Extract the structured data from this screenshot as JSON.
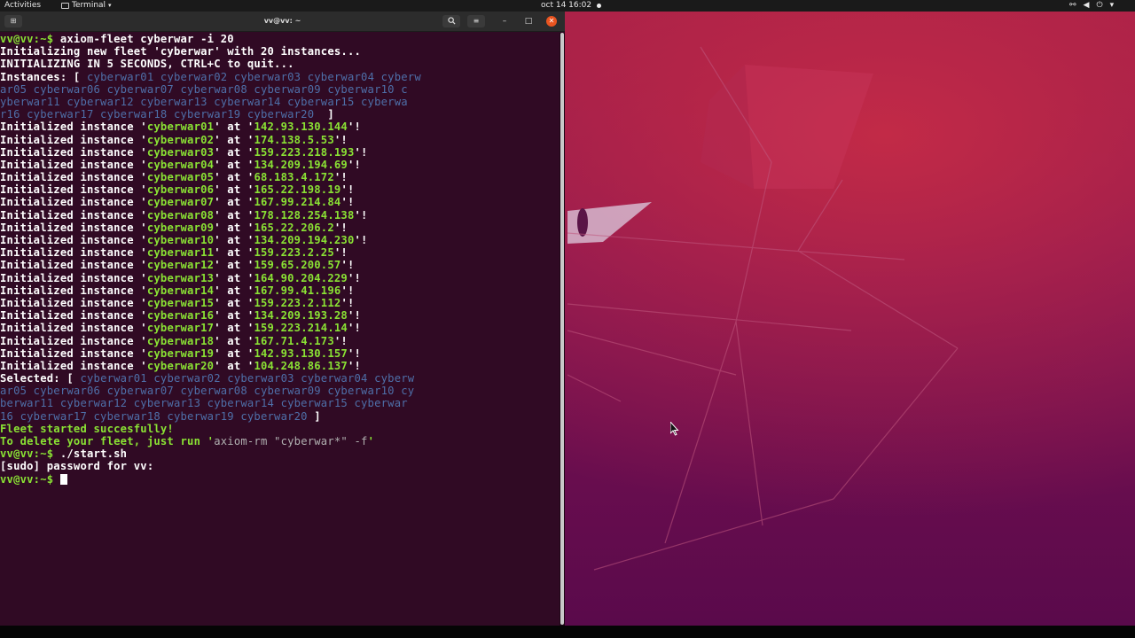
{
  "topbar": {
    "activities": "Activities",
    "app_name": "Terminal",
    "clock": "oct 14  16:02",
    "tray_icons": [
      "network-icon",
      "volume-icon",
      "power-icon"
    ]
  },
  "terminal": {
    "title": "vv@vv: ~",
    "lines": [
      [
        {
          "t": "vv@vv:~$ ",
          "c": "prompt"
        },
        {
          "t": "axiom-fleet cyberwar -i 20",
          "c": "cmd"
        }
      ],
      [
        {
          "t": "Initializing new fleet 'cyberwar' with 20 instances...",
          "c": "white"
        }
      ],
      [
        {
          "t": "INITIALIZING IN 5 SECONDS, CTRL+C to quit...",
          "c": "white"
        }
      ],
      [
        {
          "t": "Instances: [ ",
          "c": "white"
        },
        {
          "t": "cyberwar01 cyberwar02 cyberwar03 cyberwar04 cyberw",
          "c": "inst"
        }
      ],
      [
        {
          "t": "ar05 cyberwar06 cyberwar07 cyberwar08 cyberwar09 cyberwar10 c",
          "c": "inst"
        }
      ],
      [
        {
          "t": "yberwar11 cyberwar12 cyberwar13 cyberwar14 cyberwar15 cyberwa",
          "c": "inst"
        }
      ],
      [
        {
          "t": "r16 cyberwar17 cyberwar18 cyberwar19 cyberwar20 ",
          "c": "inst"
        },
        {
          "t": " ]",
          "c": "white"
        }
      ],
      [
        {
          "t": "Initialized instance '",
          "c": "white"
        },
        {
          "t": "cyberwar01",
          "c": "green"
        },
        {
          "t": "' at '",
          "c": "white"
        },
        {
          "t": "142.93.130.144",
          "c": "green"
        },
        {
          "t": "'!",
          "c": "white"
        }
      ],
      [
        {
          "t": "Initialized instance '",
          "c": "white"
        },
        {
          "t": "cyberwar02",
          "c": "green"
        },
        {
          "t": "' at '",
          "c": "white"
        },
        {
          "t": "174.138.5.53",
          "c": "green"
        },
        {
          "t": "'!",
          "c": "white"
        }
      ],
      [
        {
          "t": "Initialized instance '",
          "c": "white"
        },
        {
          "t": "cyberwar03",
          "c": "green"
        },
        {
          "t": "' at '",
          "c": "white"
        },
        {
          "t": "159.223.218.193",
          "c": "green"
        },
        {
          "t": "'!",
          "c": "white"
        }
      ],
      [
        {
          "t": "Initialized instance '",
          "c": "white"
        },
        {
          "t": "cyberwar04",
          "c": "green"
        },
        {
          "t": "' at '",
          "c": "white"
        },
        {
          "t": "134.209.194.69",
          "c": "green"
        },
        {
          "t": "'!",
          "c": "white"
        }
      ],
      [
        {
          "t": "Initialized instance '",
          "c": "white"
        },
        {
          "t": "cyberwar05",
          "c": "green"
        },
        {
          "t": "' at '",
          "c": "white"
        },
        {
          "t": "68.183.4.172",
          "c": "green"
        },
        {
          "t": "'!",
          "c": "white"
        }
      ],
      [
        {
          "t": "Initialized instance '",
          "c": "white"
        },
        {
          "t": "cyberwar06",
          "c": "green"
        },
        {
          "t": "' at '",
          "c": "white"
        },
        {
          "t": "165.22.198.19",
          "c": "green"
        },
        {
          "t": "'!",
          "c": "white"
        }
      ],
      [
        {
          "t": "Initialized instance '",
          "c": "white"
        },
        {
          "t": "cyberwar07",
          "c": "green"
        },
        {
          "t": "' at '",
          "c": "white"
        },
        {
          "t": "167.99.214.84",
          "c": "green"
        },
        {
          "t": "'!",
          "c": "white"
        }
      ],
      [
        {
          "t": "Initialized instance '",
          "c": "white"
        },
        {
          "t": "cyberwar08",
          "c": "green"
        },
        {
          "t": "' at '",
          "c": "white"
        },
        {
          "t": "178.128.254.138",
          "c": "green"
        },
        {
          "t": "'!",
          "c": "white"
        }
      ],
      [
        {
          "t": "Initialized instance '",
          "c": "white"
        },
        {
          "t": "cyberwar09",
          "c": "green"
        },
        {
          "t": "' at '",
          "c": "white"
        },
        {
          "t": "165.22.206.2",
          "c": "green"
        },
        {
          "t": "'!",
          "c": "white"
        }
      ],
      [
        {
          "t": "Initialized instance '",
          "c": "white"
        },
        {
          "t": "cyberwar10",
          "c": "green"
        },
        {
          "t": "' at '",
          "c": "white"
        },
        {
          "t": "134.209.194.230",
          "c": "green"
        },
        {
          "t": "'!",
          "c": "white"
        }
      ],
      [
        {
          "t": "Initialized instance '",
          "c": "white"
        },
        {
          "t": "cyberwar11",
          "c": "green"
        },
        {
          "t": "' at '",
          "c": "white"
        },
        {
          "t": "159.223.2.25",
          "c": "green"
        },
        {
          "t": "'!",
          "c": "white"
        }
      ],
      [
        {
          "t": "Initialized instance '",
          "c": "white"
        },
        {
          "t": "cyberwar12",
          "c": "green"
        },
        {
          "t": "' at '",
          "c": "white"
        },
        {
          "t": "159.65.200.57",
          "c": "green"
        },
        {
          "t": "'!",
          "c": "white"
        }
      ],
      [
        {
          "t": "Initialized instance '",
          "c": "white"
        },
        {
          "t": "cyberwar13",
          "c": "green"
        },
        {
          "t": "' at '",
          "c": "white"
        },
        {
          "t": "164.90.204.229",
          "c": "green"
        },
        {
          "t": "'!",
          "c": "white"
        }
      ],
      [
        {
          "t": "Initialized instance '",
          "c": "white"
        },
        {
          "t": "cyberwar14",
          "c": "green"
        },
        {
          "t": "' at '",
          "c": "white"
        },
        {
          "t": "167.99.41.196",
          "c": "green"
        },
        {
          "t": "'!",
          "c": "white"
        }
      ],
      [
        {
          "t": "Initialized instance '",
          "c": "white"
        },
        {
          "t": "cyberwar15",
          "c": "green"
        },
        {
          "t": "' at '",
          "c": "white"
        },
        {
          "t": "159.223.2.112",
          "c": "green"
        },
        {
          "t": "'!",
          "c": "white"
        }
      ],
      [
        {
          "t": "Initialized instance '",
          "c": "white"
        },
        {
          "t": "cyberwar16",
          "c": "green"
        },
        {
          "t": "' at '",
          "c": "white"
        },
        {
          "t": "134.209.193.28",
          "c": "green"
        },
        {
          "t": "'!",
          "c": "white"
        }
      ],
      [
        {
          "t": "Initialized instance '",
          "c": "white"
        },
        {
          "t": "cyberwar17",
          "c": "green"
        },
        {
          "t": "' at '",
          "c": "white"
        },
        {
          "t": "159.223.214.14",
          "c": "green"
        },
        {
          "t": "'!",
          "c": "white"
        }
      ],
      [
        {
          "t": "Initialized instance '",
          "c": "white"
        },
        {
          "t": "cyberwar18",
          "c": "green"
        },
        {
          "t": "' at '",
          "c": "white"
        },
        {
          "t": "167.71.4.173",
          "c": "green"
        },
        {
          "t": "'!",
          "c": "white"
        }
      ],
      [
        {
          "t": "Initialized instance '",
          "c": "white"
        },
        {
          "t": "cyberwar19",
          "c": "green"
        },
        {
          "t": "' at '",
          "c": "white"
        },
        {
          "t": "142.93.130.157",
          "c": "green"
        },
        {
          "t": "'!",
          "c": "white"
        }
      ],
      [
        {
          "t": "Initialized instance '",
          "c": "white"
        },
        {
          "t": "cyberwar20",
          "c": "green"
        },
        {
          "t": "' at '",
          "c": "white"
        },
        {
          "t": "104.248.86.137",
          "c": "green"
        },
        {
          "t": "'!",
          "c": "white"
        }
      ],
      [
        {
          "t": "Selected: [ ",
          "c": "white"
        },
        {
          "t": "cyberwar01 cyberwar02 cyberwar03 cyberwar04 cyberw",
          "c": "inst"
        }
      ],
      [
        {
          "t": "ar05 cyberwar06 cyberwar07 cyberwar08 cyberwar09 cyberwar10 cy",
          "c": "inst"
        }
      ],
      [
        {
          "t": "berwar11 cyberwar12 cyberwar13 cyberwar14 cyberwar15 cyberwar",
          "c": "inst"
        }
      ],
      [
        {
          "t": "16 cyberwar17 cyberwar18 cyberwar19 cyberwar20 ",
          "c": "inst"
        },
        {
          "t": "]",
          "c": "white"
        }
      ],
      [
        {
          "t": "Fleet started succesfully!",
          "c": "green"
        }
      ],
      [
        {
          "t": "To delete your fleet, just run '",
          "c": "green"
        },
        {
          "t": "axiom-rm \"cyberwar*\" -f",
          "c": "gray"
        },
        {
          "t": "'",
          "c": "green"
        }
      ],
      [
        {
          "t": "vv@vv:~$ ",
          "c": "prompt"
        },
        {
          "t": "./start.sh",
          "c": "cmd"
        }
      ],
      [
        {
          "t": "[sudo] password for vv:",
          "c": "white"
        }
      ],
      [
        {
          "t": "vv@vv:~$ ",
          "c": "prompt"
        }
      ]
    ]
  },
  "colors": {
    "terminal_bg": "#300a24",
    "prompt_green": "#8ae234",
    "instance_blue": "#4e6fa8",
    "close_orange": "#e95420"
  }
}
